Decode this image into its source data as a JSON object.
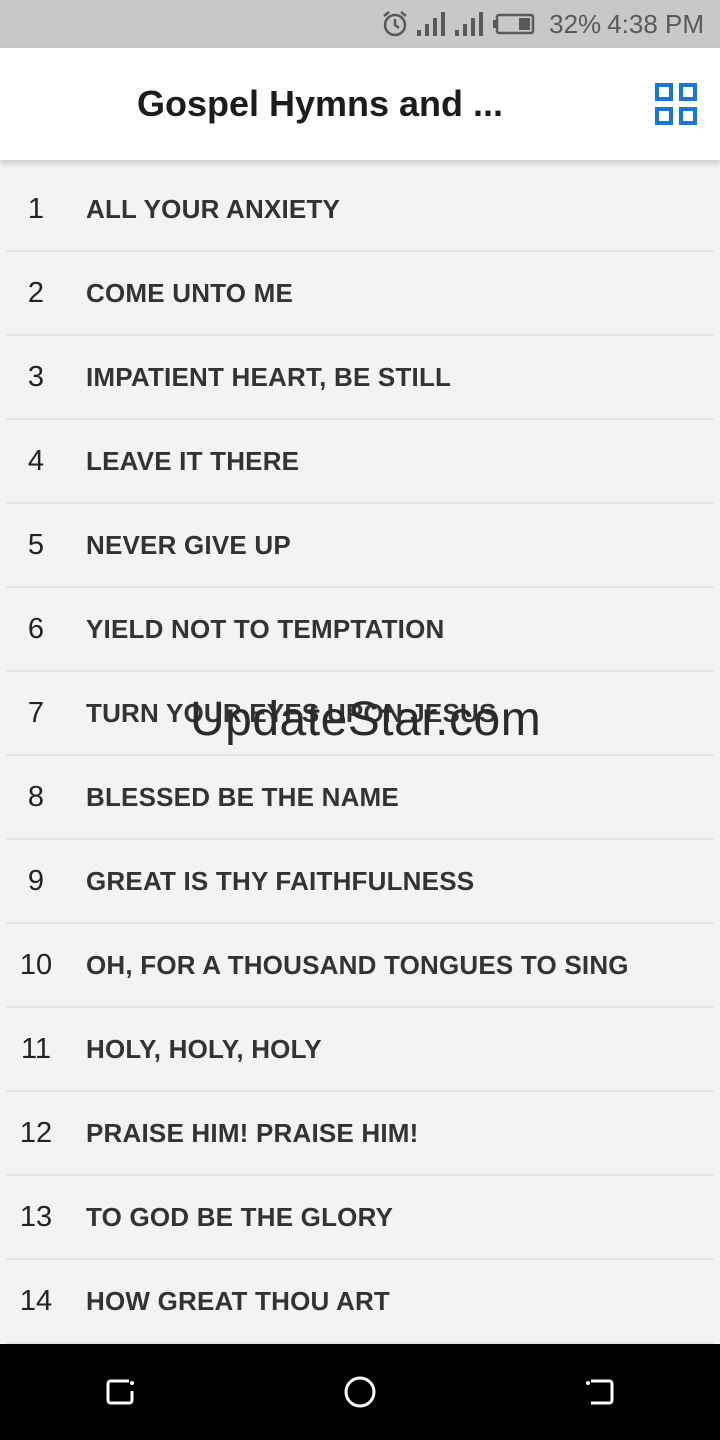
{
  "status": {
    "battery": "32%",
    "time": "4:38 PM",
    "icons": [
      "alarm-icon",
      "signal-icon",
      "signal-icon",
      "battery-icon"
    ]
  },
  "appbar": {
    "title": "Gospel Hymns and ...",
    "grid_icon": "grid-view-icon",
    "accent": "#1976d2"
  },
  "hymns": [
    {
      "number": "1",
      "title": "ALL YOUR ANXIETY"
    },
    {
      "number": "2",
      "title": "COME UNTO ME"
    },
    {
      "number": "3",
      "title": "IMPATIENT HEART, BE STILL"
    },
    {
      "number": "4",
      "title": "LEAVE IT THERE"
    },
    {
      "number": "5",
      "title": "NEVER GIVE UP"
    },
    {
      "number": "6",
      "title": "YIELD NOT TO TEMPTATION"
    },
    {
      "number": "7",
      "title": "TURN YOUR EYES UPON JESUS"
    },
    {
      "number": "8",
      "title": "BLESSED BE THE NAME"
    },
    {
      "number": "9",
      "title": "GREAT IS THY FAITHFULNESS"
    },
    {
      "number": "10",
      "title": "OH, FOR A THOUSAND TONGUES TO SING"
    },
    {
      "number": "11",
      "title": "HOLY, HOLY, HOLY"
    },
    {
      "number": "12",
      "title": "PRAISE HIM! PRAISE HIM!"
    },
    {
      "number": "13",
      "title": "TO GOD BE THE GLORY"
    },
    {
      "number": "14",
      "title": "HOW GREAT THOU ART"
    }
  ],
  "watermark": "UpdateStar.com",
  "navbar": {
    "icons": [
      "recent-apps-icon",
      "home-icon",
      "back-icon"
    ]
  }
}
